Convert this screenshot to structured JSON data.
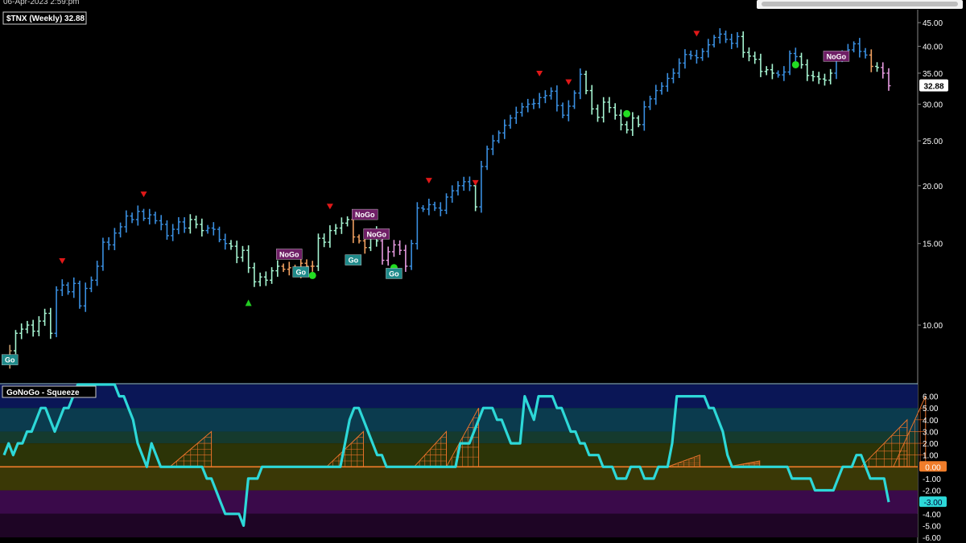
{
  "header": {
    "timestamp": "06-Apr-2023 2:59:pm"
  },
  "colors": {
    "go_strong": "#3a8fe0",
    "go_weak": "#a6f5d2",
    "nogo_weak": "#f0a060",
    "nogo_strong": "#e79be0",
    "neutral": "#c39a6b",
    "go_flag": "#1f8a8a",
    "nogo_flag": "#6f1f66",
    "oscillator": "#2dd8d8",
    "zero_line": "#f07d2a",
    "squeeze_grid": "#e8722a",
    "up_marker": "#22cc22",
    "down_marker": "#e01818",
    "dot_marker": "#22dd22"
  },
  "chart_data": [
    {
      "type": "line",
      "title": "$TNX (Weekly) 32.88",
      "y_scale": "log",
      "ylim": [
        7.5,
        48
      ],
      "y_ticks": [
        45,
        40,
        35,
        30,
        25,
        20,
        15,
        10
      ],
      "y_tick_labels": [
        "45.00",
        "40.00",
        "35.00",
        "30.00",
        "25.00",
        "20.00",
        "15.00",
        "10.00"
      ],
      "last_value": 32.88,
      "last_value_label": "32.88",
      "series": [
        {
          "color_key": [
            "N",
            "N",
            "G",
            "G",
            "G",
            "G",
            "G",
            "G",
            "G",
            "B",
            "B",
            "B",
            "B",
            "B",
            "B",
            "B",
            "B",
            "B",
            "B",
            "B",
            "B",
            "B",
            "B",
            "B",
            "B",
            "B",
            "B",
            "B",
            "B",
            "B",
            "B",
            "B",
            "G",
            "G",
            "G",
            "B",
            "B",
            "B",
            "B",
            "G",
            "G",
            "G",
            "G",
            "G",
            "G",
            "G",
            "G",
            "G",
            "O",
            "O",
            "O",
            "O",
            "O",
            "O",
            "G",
            "G",
            "G",
            "G",
            "G",
            "G",
            "O",
            "O",
            "O",
            "G",
            "G",
            "P",
            "P",
            "P",
            "P",
            "P",
            "B",
            "B",
            "B",
            "B",
            "B",
            "B",
            "B",
            "B",
            "B",
            "B",
            "B",
            "G",
            "B",
            "B",
            "B",
            "B",
            "B",
            "B",
            "B",
            "B",
            "B",
            "B",
            "B",
            "B",
            "B",
            "B",
            "B",
            "B",
            "B",
            "B",
            "G",
            "G",
            "G",
            "G",
            "G",
            "G",
            "G",
            "G",
            "G",
            "G",
            "B",
            "B",
            "B",
            "B",
            "B",
            "B",
            "B",
            "B",
            "B",
            "B",
            "B",
            "B",
            "B",
            "B",
            "B",
            "B",
            "B",
            "G",
            "G",
            "G",
            "G",
            "G",
            "G",
            "B",
            "B",
            "B",
            "B",
            "G",
            "G",
            "G",
            "G",
            "G",
            "G",
            "B",
            "B",
            "B",
            "B",
            "B",
            "B",
            "O",
            "G",
            "P",
            "P"
          ],
          "close": [
            8.3,
            8.8,
            9.6,
            9.8,
            10.0,
            9.7,
            10.2,
            10.6,
            9.6,
            11.9,
            12.2,
            11.8,
            12.3,
            11.0,
            12.0,
            12.5,
            13.4,
            15.1,
            14.9,
            15.8,
            16.3,
            17.2,
            16.9,
            17.6,
            17.0,
            17.3,
            16.8,
            16.5,
            15.6,
            16.1,
            16.7,
            16.2,
            16.9,
            16.5,
            16.0,
            16.2,
            16.1,
            15.3,
            15.0,
            14.8,
            14.0,
            14.5,
            13.3,
            12.4,
            12.7,
            12.5,
            13.1,
            13.4,
            13.2,
            13.3,
            13.0,
            13.6,
            13.4,
            13.4,
            15.4,
            15.1,
            16.0,
            16.2,
            16.6,
            16.9,
            15.5,
            15.2,
            14.7,
            15.9,
            15.2,
            13.8,
            14.4,
            14.9,
            14.5,
            13.4,
            15.0,
            17.9,
            17.8,
            18.2,
            17.9,
            17.7,
            18.9,
            19.5,
            20.0,
            20.4,
            20.0,
            18.0,
            22.0,
            24.0,
            25.0,
            26.0,
            27.0,
            28.0,
            28.8,
            29.6,
            30.0,
            30.1,
            31.0,
            31.3,
            32.0,
            29.8,
            28.4,
            29.7,
            31.7,
            34.8,
            32.1,
            29.3,
            28.1,
            30.3,
            29.5,
            28.4,
            27.1,
            26.4,
            28.0,
            27.1,
            29.6,
            30.8,
            32.1,
            32.8,
            34.1,
            35.0,
            36.8,
            38.4,
            38.2,
            37.8,
            39.0,
            40.3,
            41.8,
            42.5,
            41.4,
            40.6,
            42.0,
            38.8,
            38.1,
            37.5,
            35.3,
            35.6,
            35.0,
            34.7,
            35.2,
            38.6,
            38.0,
            36.5,
            34.6,
            34.4,
            34.0,
            33.8,
            35.0,
            37.6,
            38.6,
            39.3,
            40.5,
            39.0,
            38.3,
            36.2,
            36.0,
            35.0,
            32.88
          ]
        }
      ],
      "annotations": [
        {
          "kind": "down",
          "x": 14
        },
        {
          "kind": "down",
          "x": 34
        },
        {
          "kind": "down",
          "x": 80
        },
        {
          "kind": "down",
          "x": 104
        },
        {
          "kind": "down",
          "x": 116
        },
        {
          "kind": "down",
          "x": 132
        },
        {
          "kind": "down",
          "x": 138
        },
        {
          "kind": "down",
          "x": 170
        },
        {
          "kind": "up",
          "x": 60
        },
        {
          "kind": "dot",
          "x": 75,
          "y": 12.8
        },
        {
          "kind": "dot",
          "x": 96,
          "y": 13.3
        },
        {
          "kind": "dot",
          "x": 153,
          "y": 28.6
        },
        {
          "kind": "dot",
          "x": 194,
          "y": 36.5
        }
      ],
      "labels": [
        {
          "text": "Go",
          "kind": "go",
          "x": 2,
          "y": 8.4
        },
        {
          "text": "NoGo",
          "kind": "nogo",
          "x": 70,
          "y": 14.2
        },
        {
          "text": "Go",
          "kind": "go",
          "x": 73,
          "y": 13.0
        },
        {
          "text": "Go",
          "kind": "go",
          "x": 85,
          "y": 13.8
        },
        {
          "text": "NoGo",
          "kind": "nogo",
          "x": 89,
          "y": 17.3
        },
        {
          "text": "NoGo",
          "kind": "nogo",
          "x": 92,
          "y": 15.7
        },
        {
          "text": "Go",
          "kind": "go",
          "x": 95,
          "y": 12.9
        },
        {
          "text": "NoGo",
          "kind": "nogo",
          "x": 204,
          "y": 38.0
        }
      ]
    },
    {
      "type": "line",
      "title": "GoNoGo - Squeeze",
      "ylim": [
        -6,
        7
      ],
      "y_ticks": [
        6,
        5,
        4,
        3,
        2,
        1,
        0,
        -1,
        -2,
        -3,
        -4,
        -5,
        -6
      ],
      "y_tick_labels": [
        "6.00",
        "5.00",
        "4.00",
        "3.00",
        "2.00",
        "1.00",
        "0.00",
        "-1.00",
        "-2.00",
        "-3.00",
        "-4.00",
        "-5.00",
        "-6.00"
      ],
      "zero_label": "0.00",
      "last_value": -3,
      "last_value_label": "-3.00",
      "series": [
        {
          "values": [
            1,
            2,
            1,
            2,
            2,
            3,
            3,
            4,
            5,
            5,
            4,
            3,
            4,
            5,
            5,
            6,
            7,
            7,
            7,
            7,
            7,
            7,
            7,
            7,
            7,
            6,
            6,
            5,
            4,
            2,
            1,
            0,
            2,
            1,
            0,
            0,
            0,
            0,
            0,
            0,
            0,
            0,
            0,
            0,
            -1,
            -1,
            -2,
            -3,
            -4,
            -4,
            -4,
            -4,
            -5,
            -1,
            -1,
            -1,
            0,
            0,
            0,
            0,
            0,
            0,
            0,
            0,
            0,
            0,
            0,
            0,
            0,
            0,
            0,
            0,
            0,
            0,
            2,
            4,
            5,
            5,
            4,
            3,
            2,
            1,
            1,
            0,
            0,
            0,
            0,
            0,
            0,
            0,
            0,
            0,
            0,
            0,
            0,
            0,
            0,
            0,
            0,
            2,
            2,
            2,
            3,
            4,
            5,
            5,
            5,
            4,
            4,
            3,
            2,
            2,
            2,
            6,
            5,
            4,
            6,
            6,
            6,
            6,
            5,
            5,
            4,
            3,
            3,
            2,
            2,
            1,
            1,
            1,
            0,
            0,
            0,
            -1,
            -1,
            -1,
            0,
            0,
            0,
            -1,
            -1,
            -1,
            0,
            0,
            0,
            2,
            6,
            6,
            6,
            6,
            6,
            6,
            6,
            5,
            5,
            4,
            3,
            1,
            0,
            0,
            0,
            0,
            0,
            0,
            0,
            0,
            0,
            0,
            0,
            0,
            0,
            -1,
            -1,
            -1,
            -1,
            -1,
            -2,
            -2,
            -2,
            -2,
            -2,
            -1,
            0,
            0,
            0,
            1,
            1,
            0,
            -1,
            -1,
            -1,
            -1,
            -3
          ]
        }
      ]
    }
  ]
}
